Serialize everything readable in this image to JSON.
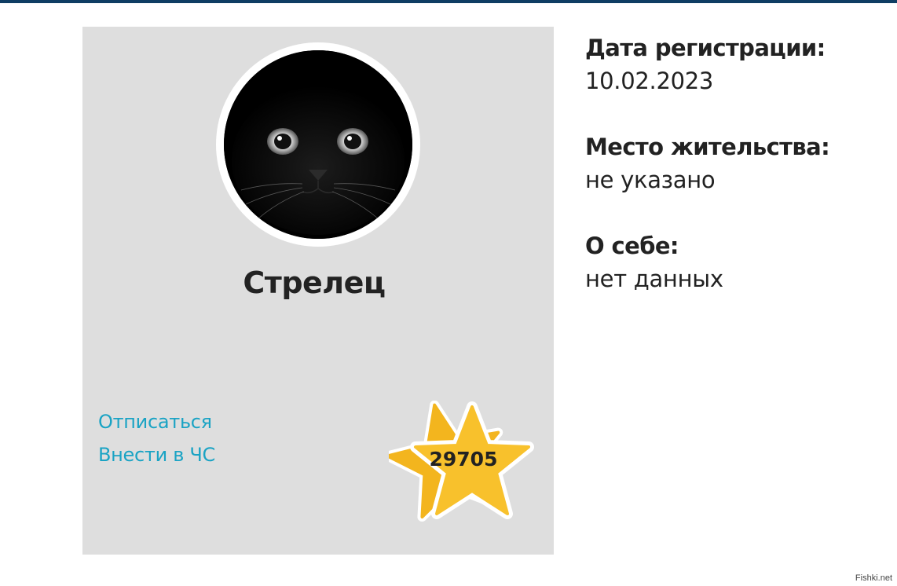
{
  "profile": {
    "username": "Стрелец",
    "avatar_icon": "black-cat-avatar",
    "actions": {
      "unsubscribe_label": "Отписаться",
      "blacklist_label": "Внести в ЧС"
    },
    "rating": {
      "value": "29705",
      "icon": "star-icon",
      "color": "#f8c12c"
    }
  },
  "info": {
    "registration_label": "Дата регистрации:",
    "registration_value": "10.02.2023",
    "location_label": "Место жительства:",
    "location_value": "не указано",
    "about_label": "О себе:",
    "about_value": "нет данных"
  },
  "watermark": "Fishki.net",
  "colors": {
    "top_bar": "#0f3d63",
    "card_background": "#dedede",
    "link": "#1aa3c4",
    "text": "#222222"
  }
}
